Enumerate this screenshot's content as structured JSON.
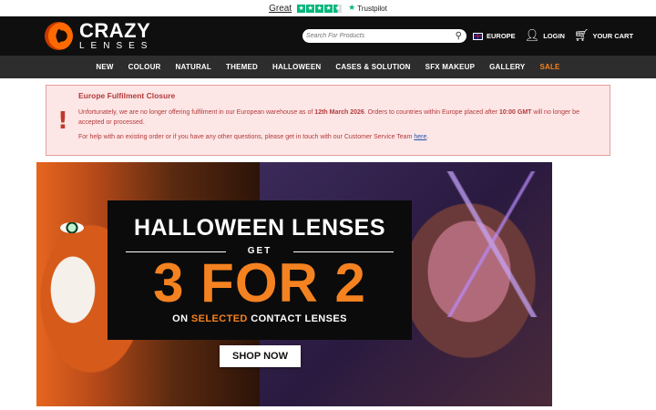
{
  "trustbar": {
    "rating_word": "Great",
    "brand": "Trustpilot",
    "stars": 4.5
  },
  "header": {
    "logo_line1": "CRAZY",
    "logo_line2": "LENSES",
    "search_placeholder": "Search For Products",
    "region_label": "EUROPE",
    "login_label": "LOGIN",
    "cart_label": "YOUR CART"
  },
  "nav": {
    "items": [
      "NEW",
      "COLOUR",
      "NATURAL",
      "THEMED",
      "HALLOWEEN",
      "CASES & SOLUTION",
      "SFX MAKEUP",
      "GALLERY",
      "SALE"
    ]
  },
  "alert": {
    "title": "Europe Fulfilment Closure",
    "p1_a": "Unfortunately, we are no longer offering fulfilment in our European warehouse as of ",
    "p1_date": "12th March 2026",
    "p1_b": ". Orders to countries within Europe placed after ",
    "p1_time": "10:00 GMT",
    "p1_c": " will no longer be accepted or processed.",
    "p2": "For help with an existing order or if you have any other questions, please get in touch with our Customer Service Team ",
    "p2_link": "here",
    "p2_end": "."
  },
  "banner": {
    "headline": "HALLOWEEN LENSES",
    "get": "GET",
    "offer": "3 FOR 2",
    "sub_a": "ON ",
    "sub_hl": "SELECTED",
    "sub_b": " CONTACT LENSES",
    "cta": "SHOP NOW"
  },
  "colors": {
    "accent": "#f58220",
    "nav_bg": "#2d2d2d",
    "header_bg": "#0f0f0f",
    "alert_bg": "#fde6e6",
    "alert_text": "#b33a3a",
    "trustpilot_green": "#00b67a"
  }
}
